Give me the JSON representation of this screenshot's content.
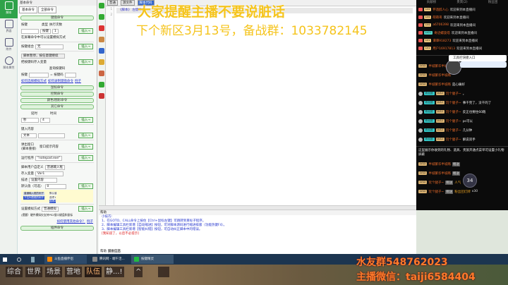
{
  "nav": [
    {
      "label": "脚本"
    },
    {
      "label": "界面"
    },
    {
      "label": "附件"
    },
    {
      "label": "脚本属性"
    }
  ],
  "panel": {
    "title": "基本命令",
    "tabs": [
      "基本命令",
      "全部命令"
    ],
    "key_cmd": "键盘命令",
    "key_label": "按键",
    "type_label": "类型",
    "times_label": "执行次数",
    "type_value": "按键",
    "times_value": "1",
    "bg_hint": "在屏幕命令中可以设置模拟方式",
    "combo_label": "按键组合",
    "combo_value": "无",
    "pause_select": "脚本暂停，按任意键继续",
    "save_key_label": "把按键码存入变量",
    "query_label": "查询按键码",
    "key2": "按键",
    "keycode": "= 按键码",
    "links": [
      "如何选择模拟方式",
      "如何录制键盘命令",
      "例子"
    ],
    "groups": [
      "鼠标命令",
      "控制命令",
      "颜色/图形命令",
      "其它命令"
    ],
    "delay_label": "延时",
    "time_label": "时间",
    "delay_unit": "秒",
    "delay_value": "4",
    "input_label": "键入内容",
    "input_type": "文本",
    "popup_label": "弹出窗口(脚本重接)",
    "popup_content": "窗口提示内容",
    "run_label": "运行程序",
    "run_value": "\"notepad.exe\"",
    "custom_label": "脚本用户自定义",
    "custom_select": "普通输入框",
    "var_label": "存入变量",
    "var_value": "Var1",
    "desc_label": "描述",
    "desc_value": "设置内容",
    "default_label": "默认值（可选）",
    "default_value": "0",
    "preview": [
      "普通输入框的例子",
      "下拉列表框的例子",
      "默认值",
      "选项1",
      "选项2"
    ],
    "sim_label": "设置模拟方式",
    "sim_value": "普通模拟",
    "sim_hint": "(提醒）硬件模拟仅支持PS2接口键盘和鼠标",
    "plugin_link": "如何使用其他命令？",
    "plugin_example": "例子",
    "plugin_cmd": "插件命令",
    "insert": "插入→"
  },
  "editor": {
    "tabs": [
      "普通",
      "源文件",
      "脚本代码"
    ],
    "lines": [
      "1",
      "2"
    ],
    "code": "《脚本》 左键单击"
  },
  "overlay": {
    "line1": "大家提醒主播不要说脏话",
    "line2": "下个新区3月13号，备战群：1033782145"
  },
  "help": {
    "title": "帮助",
    "lines": [
      "小技巧:",
      "1、在GOTO、CALL命令上按住【Ctrl+鼠标左键】可跳转到目标子程序。",
      "2、脚本编辑工具栏新增【自动缩进】按钮，可对脚本源码进行缩进排版（功能热键F4）。",
      "3、脚本编辑工具栏新增【智能纠错】按钮，可自动纠正脚本中的错误。"
    ],
    "dismiss": "[我知道了，以后不必提示]",
    "tabs": [
      "帮助",
      "脚本信息"
    ]
  },
  "chat": {
    "tabs": [
      "贡献榜",
      "贵宾(2)",
      "粉丝团"
    ],
    "joins": [
      {
        "lv": "LV4",
        "name": "怀酒醉人心",
        "msg": "欢迎来到本直播间",
        "c": "#e8c27a"
      },
      {
        "lv": "LV4",
        "name": "萌萌哥",
        "msg": "欢迎来到本直播间",
        "c": "#e8c27a"
      },
      {
        "lv": "LV4",
        "name": "a6706398",
        "msg": "欢迎来到本直播间",
        "c": "#e8c27a"
      },
      {
        "lv": "LV21",
        "name": "奇迹螺旋塔",
        "msg": "欢迎来到本直播间",
        "c": "#4fd1c5"
      },
      {
        "lv": "LV1",
        "name": "谭谭918273",
        "msg": "欢迎来到本直播间",
        "c": "#e8c27a"
      },
      {
        "lv": "LV1",
        "name": "用户169178​13",
        "msg": "欢迎来到本直播间",
        "c": "#e8c27a"
      }
    ],
    "popup": "工具栏快捷入口",
    "msgs": [
      {
        "name": "半城繁华半城殇",
        "msg": ""
      },
      {
        "name": "半城繁华半城殇",
        "msg": ""
      },
      {
        "name": "半城繁华半城殇",
        "msg": "是心痛好"
      },
      {
        "name": "玩个腿子~",
        "msg": "。"
      },
      {
        "name": "玩个腿子~",
        "msg": "事干完了，没干的了"
      },
      {
        "name": "玩个腿子~",
        "msg": "反正也要往60跑"
      },
      {
        "name": "玩个腿子~",
        "msg": "pc可以"
      },
      {
        "name": "玩个腿子~",
        "msg": "几分钟"
      },
      {
        "name": "玩个腿子~",
        "msg": "解说双手"
      }
    ],
    "fan_badge": "粉丝团",
    "lv_badge": "LV12",
    "gift_notice": "这里展示你收到的礼物、道具、贵族开通点菜单可设置小礼物屏蔽",
    "gifts": [
      {
        "name": "半城繁华半城殇",
        "action": "赠送"
      },
      {
        "name": "半城繁华半城殇",
        "action": "赠送"
      },
      {
        "name": "玩个腿子~",
        "action": "赠送",
        "item": "人气"
      },
      {
        "name": "玩个腿子~",
        "action": "赠送",
        "item": "粉丝团灯牌",
        "count": "x30"
      }
    ],
    "gauge": "34"
  },
  "taskbar": {
    "items": [
      "斗鱼直播伴侣",
      "腾讯网 - 端午活...",
      "按键精灵"
    ]
  },
  "game": {
    "buttons": [
      "综合",
      "世界",
      "场景",
      "营地",
      "队伍",
      "静...!",
      "^"
    ]
  },
  "watermark": {
    "line1": "水友群548762023",
    "line2": "主播微信：taiji6584404"
  }
}
